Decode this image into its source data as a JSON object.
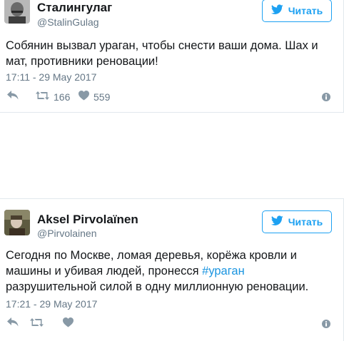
{
  "tweets": [
    {
      "name": "Сталингулаг",
      "handle": "@StalinGulag",
      "follow_label": "Читать",
      "text": "Собянин вызвал ураган, чтобы снести ваши дома. Шах и мат, противники реновации!",
      "time": "17:11 - 29 May 2017",
      "retweets": "166",
      "likes": "559"
    },
    {
      "name": "Aksel Pirvolaïnen",
      "handle": "@Pirvolainen",
      "follow_label": "Читать",
      "text_before": "Сегодня по Москве, ломая деревья, корёжа кровли и машины и убивая людей, пронесся ",
      "hashtag": "#ураган",
      "text_after": " разрушительной силой в одну миллионную реновации.",
      "time": "17:21 - 29 May 2017"
    }
  ],
  "colors": {
    "accent": "#1da1f2",
    "hashtag": "#1b95e0",
    "muted": "#657786",
    "border": "#e1e8ed"
  },
  "icons": [
    "reply-icon",
    "retweet-icon",
    "heart-icon",
    "info-icon",
    "twitter-bird-icon"
  ]
}
